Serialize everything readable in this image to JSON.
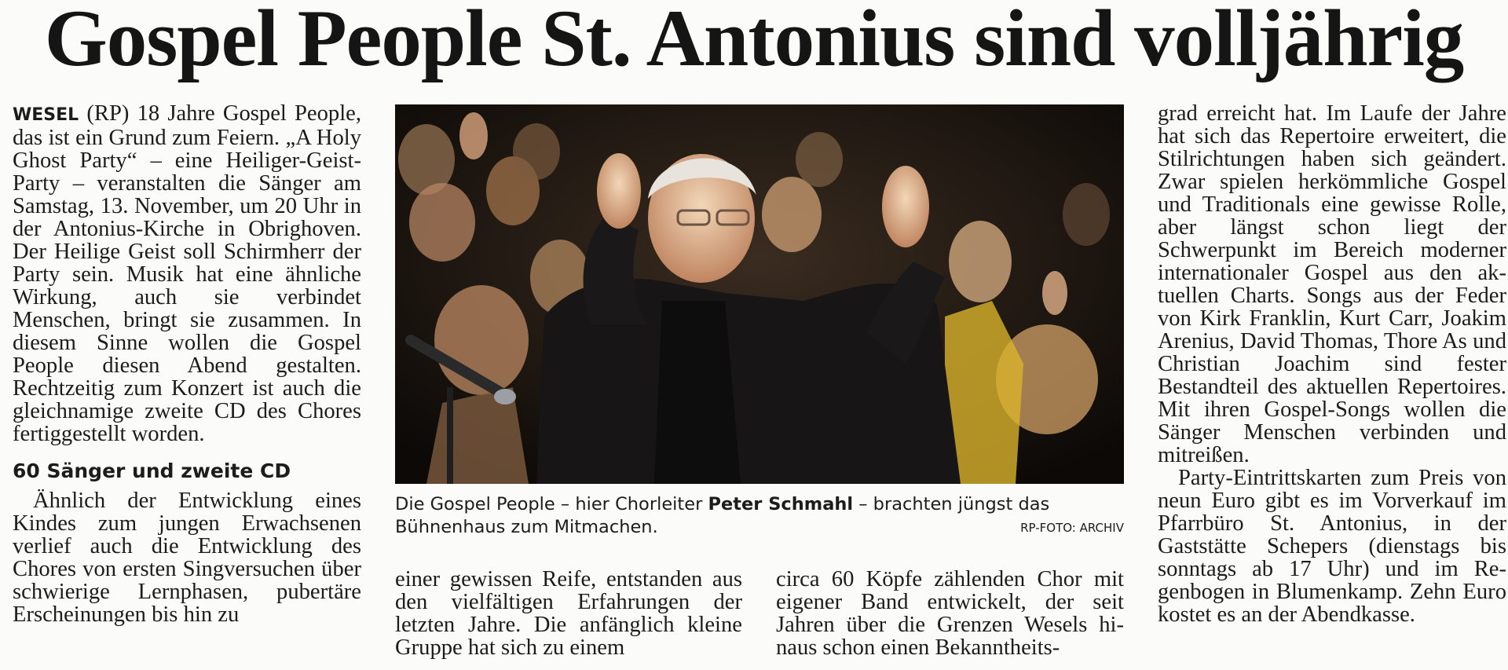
{
  "headline": "Gospel People St. Antonius sind volljährig",
  "col1": {
    "dateline": "WESEL",
    "p1": "(RP) 18 Jahre Gospel People, das ist ein Grund zum Feiern. „A Holy Ghost Party“ – eine Heiliger-Geist-Party – veranstalten die Sän­ger am Samstag, 13. November, um 20 Uhr in der Antonius-Kirche in Obrighoven. Der Heilige Geist soll Schirmherr der Party sein. Musik hat eine ähnliche Wirkung, auch sie verbindet Menschen, bringt sie zu­sammen. In diesem Sinne wollen die Gospel People diesen Abend ge­stalten. Rechtzeitig zum Konzert ist auch die gleichnamige zweite CD des Chores fertiggestellt worden.",
    "subhead": "60 Sänger und zweite CD",
    "p2": "Ähnlich der Entwicklung eines Kindes zum jungen Erwachsenen verlief auch die Entwicklung des Chores von ersten Singversuchen über schwierige Lernphasen, pu­bertäre Erscheinungen bis hin zu"
  },
  "col2": {
    "text": "einer gewissen Reife, entstanden aus den vielfältigen Erfahrungen der letzten Jahre. Die anfänglich kleine Gruppe hat sich zu einem"
  },
  "col3": {
    "text": "circa 60 Köpfe zählenden Chor mit eigener Band entwickelt, der seit Jahren über die Grenzen Wesels hi­naus schon einen Bekanntheits-"
  },
  "col4": {
    "p1": "grad erreicht hat. Im Laufe der Jah­re hat sich das Repertoire erweitert, die Stilrichtungen haben sich geän­dert. Zwar spielen herkömmliche Gospel und Traditionals eine gewis­se Rolle, aber längst schon liegt der Schwerpunkt im Bereich moderner internationaler Gospel aus den ak­tuellen Charts. Songs aus der Feder von Kirk Franklin, Kurt Carr, Joakim Arenius, David Thomas, Thore As und Christian Joachim sind fester Bestandteil des aktuellen Reper­toires. Mit ihren Gospel-Songs wol­len die Sänger Menschen verbin­den und mitreißen.",
    "p2": "Party-Eintrittskarten zum Preis von neun Euro gibt es im Vorver­kauf im Pfarrbüro St. Antonius, in der Gaststätte Schepers (dienstags bis sonntags ab 17 Uhr) und im Re­genbogen in Blumenkamp. Zehn Euro kostet es an der Abendkasse."
  },
  "caption": {
    "before": "Die Gospel People – hier Chorleiter ",
    "name": "Peter Schmahl",
    "after": " – brachten jüngst das Bühnenhaus zum Mitmachen.",
    "credit": "RP-FOTO: ARCHIV"
  }
}
